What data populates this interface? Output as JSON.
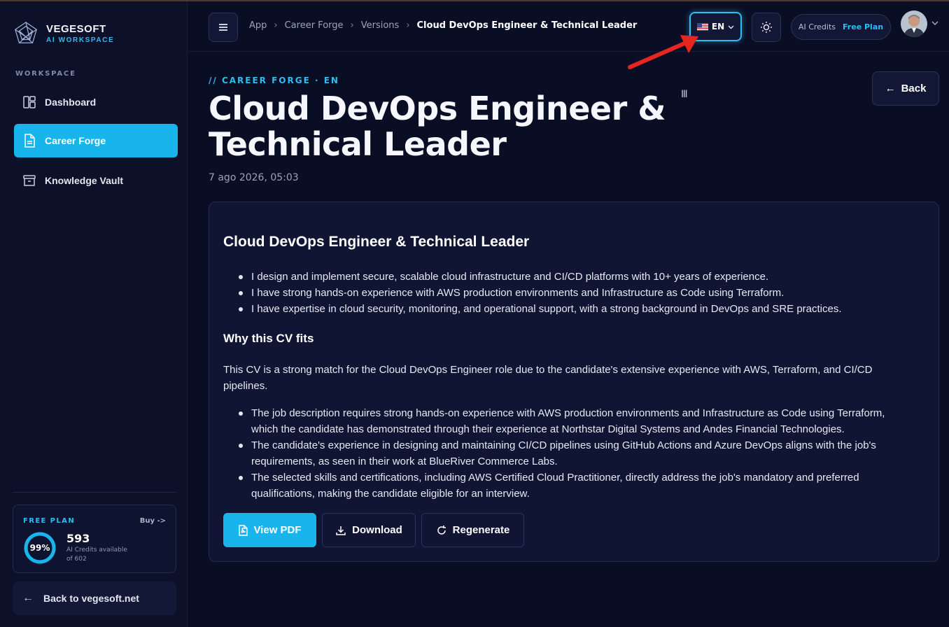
{
  "brand": {
    "name": "VEGESOFT",
    "subtitle": "AI WORKSPACE"
  },
  "sidebar": {
    "section_label": "WORKSPACE",
    "items": [
      {
        "label": "Dashboard",
        "icon": "dashboard-icon",
        "active": false
      },
      {
        "label": "Career Forge",
        "icon": "document-icon",
        "active": true
      },
      {
        "label": "Knowledge Vault",
        "icon": "archive-icon",
        "active": false
      }
    ],
    "plan": {
      "title": "FREE PLAN",
      "buy_label": "Buy ->",
      "percent_label": "99%",
      "percent": 99,
      "credits": "593",
      "credits_desc": "AI Credits available",
      "credits_total": "of 602"
    },
    "back_link": "Back to vegesoft.net"
  },
  "header": {
    "breadcrumb": [
      "App",
      "Career Forge",
      "Versions",
      "Cloud DevOps Engineer & Technical Leader"
    ],
    "language": "EN",
    "credits_label": "AI Credits",
    "plan_label": "Free Plan"
  },
  "main": {
    "eyebrow": "// CAREER FORGE · EN",
    "title": "Cloud DevOps Engineer & Technical Leader",
    "date": "7 ago 2026, 05:03",
    "back_label": "Back",
    "card": {
      "title": "Cloud DevOps Engineer & Technical Leader",
      "bullets": [
        "I design and implement secure, scalable cloud infrastructure and CI/CD platforms with 10+ years of experience.",
        "I have strong hands-on experience with AWS production environments and Infrastructure as Code using Terraform.",
        "I have expertise in cloud security, monitoring, and operational support, with a strong background in DevOps and SRE practices."
      ],
      "section_title": "Why this CV fits",
      "paragraph": "This CV is a strong match for the Cloud DevOps Engineer role due to the candidate's extensive experience with AWS, Terraform, and CI/CD pipelines.",
      "fit_bullets": [
        "The job description requires strong hands-on experience with AWS production environments and Infrastructure as Code using Terraform, which the candidate has demonstrated through their experience at Northstar Digital Systems and Andes Financial Technologies.",
        "The candidate's experience in designing and maintaining CI/CD pipelines using GitHub Actions and Azure DevOps aligns with the job's requirements, as seen in their work at BlueRiver Commerce Labs.",
        "The selected skills and certifications, including AWS Certified Cloud Practitioner, directly address the job's mandatory and preferred qualifications, making the candidate eligible for an interview."
      ],
      "actions": {
        "view_pdf": "View PDF",
        "download": "Download",
        "regenerate": "Regenerate"
      }
    }
  },
  "colors": {
    "accent": "#18b4ec",
    "background": "#0a0e24",
    "annotation": "#e5261f"
  }
}
